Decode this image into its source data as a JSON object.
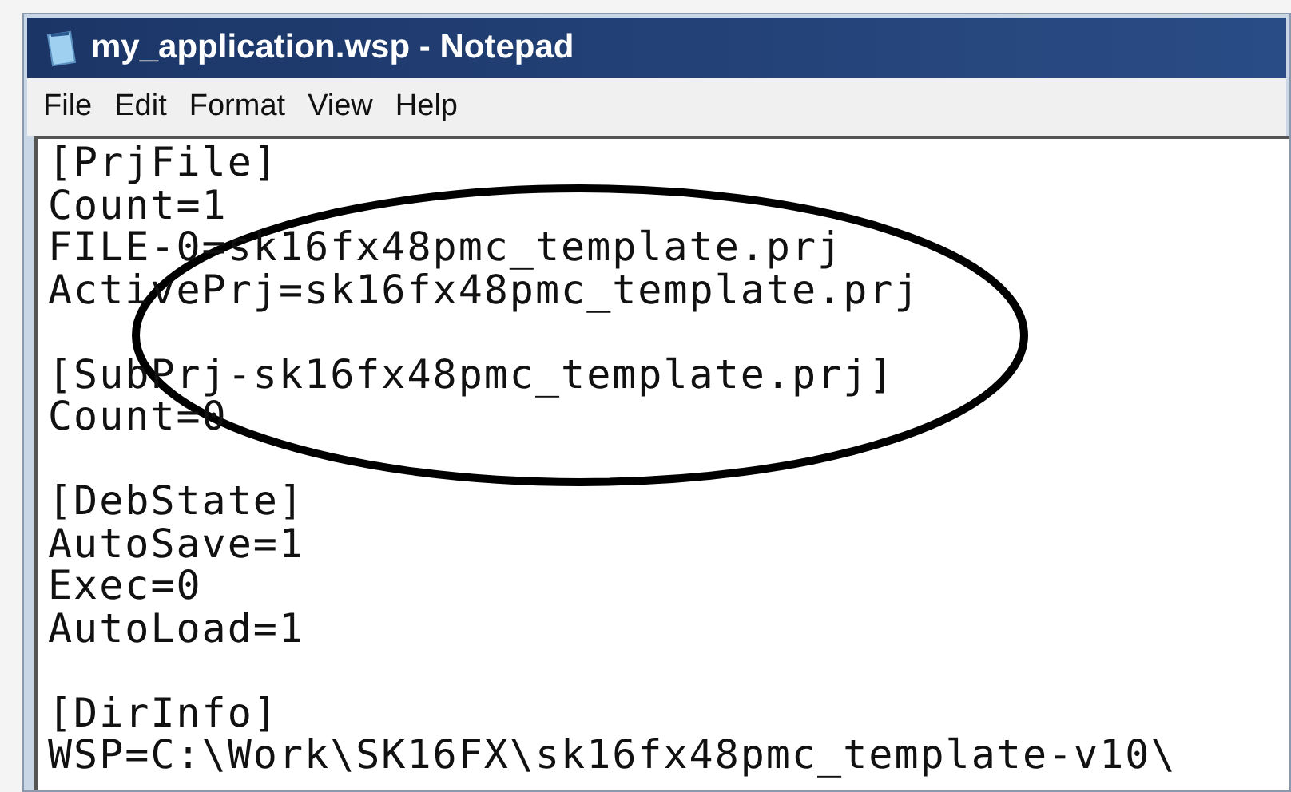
{
  "window": {
    "title": "my_application.wsp - Notepad"
  },
  "menu": [
    {
      "label": "File"
    },
    {
      "label": "Edit"
    },
    {
      "label": "Format"
    },
    {
      "label": "View"
    },
    {
      "label": "Help"
    }
  ],
  "document": {
    "sections": [
      {
        "header": "[PrjFile]",
        "lines": [
          "Count=1",
          "FILE-0=sk16fx48pmc_template.prj",
          "ActivePrj=sk16fx48pmc_template.prj"
        ]
      },
      {
        "header": "[SubPrj-sk16fx48pmc_template.prj]",
        "lines": [
          "Count=0"
        ]
      },
      {
        "header": "[DebState]",
        "lines": [
          "AutoSave=1",
          "Exec=0",
          "AutoLoad=1"
        ]
      },
      {
        "header": "[DirInfo]",
        "lines": [
          "WSP=C:\\Work\\SK16FX\\sk16fx48pmc_template-v10\\"
        ]
      }
    ]
  }
}
